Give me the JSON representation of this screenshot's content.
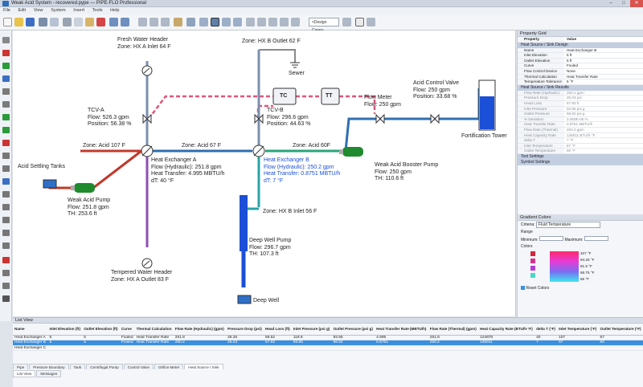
{
  "window": {
    "title": "Weak Acid System - recovered.pype — PIPE-FLO Professional"
  },
  "menu": [
    "File",
    "Edit",
    "View",
    "System",
    "Insert",
    "Tools",
    "Help"
  ],
  "toolbar": {
    "design_case": "<Design Case>"
  },
  "diagram": {
    "fresh_water_header": [
      "Fresh Water Header",
      "Zone: HX A Inlet 64 F"
    ],
    "zone_hxb_outlet": "Zone: HX B Outlet 62 F",
    "sewer": "Sewer",
    "tc": "TC",
    "tt": "TT",
    "flow_meter": [
      "Flow Meter",
      "Flow: 250 gpm"
    ],
    "acid_control_valve": [
      "Acid Control Valve",
      "Flow: 250 gpm",
      "Position: 33.68 %"
    ],
    "tcv_a": [
      "TCV-A",
      "Flow: 526.3 gpm",
      "Position: 56.38 %"
    ],
    "tcv_b": [
      "TCV-B",
      "Flow: 296.6 gpm",
      "Position: 44.63 %"
    ],
    "fortification_tower": "Fortification Tower",
    "zone_acid107": "Zone: Acid 107 F",
    "zone_acid67": "Zone: Acid 67 F",
    "zone_acid60": "Zone: Acid 60F",
    "acid_settling_tanks": "Acid Settling Tanks",
    "hx_a": [
      "Heat Exchanger A",
      "Flow (Hydraulic): 251.8 gpm",
      "Heat Transfer: 4.995 MBTU/h",
      "dT: 40 °F"
    ],
    "hx_b": [
      "Heat Exchanger B",
      "Flow (Hydraulic): 250.2 gpm",
      "Heat Transfer: 0.8751 MBTU/h",
      "dT: 7 °F"
    ],
    "booster_pump": [
      "Weak Acid Booster Pump",
      "Flow: 250 gpm",
      "TH: 110.6 ft"
    ],
    "weak_acid_pump": [
      "Weak Acid Pump",
      "Flow: 251.8 gpm",
      "TH: 253.6 ft"
    ],
    "zone_hxb_inlet": "Zone: HX B Inlet 56 F",
    "deep_well_pump": [
      "Deep Well Pump",
      "Flow: 296.7 gpm",
      "TH: 107.3 ft"
    ],
    "tempered_water_header": [
      "Tempered Water Header",
      "Zone: HX A Outlet 83 F"
    ],
    "deep_well": "Deep Well"
  },
  "property_grid": {
    "title": "Property Grid",
    "col_property": "Property",
    "col_value": "Value",
    "section1": "Heat Source / Sink Design",
    "design_rows": [
      [
        "Name",
        "Heat Exchanger B"
      ],
      [
        "Inlet Elevation",
        "5 ft"
      ],
      [
        "Outlet Elevation",
        "5 ft"
      ],
      [
        "Curve",
        "Fouled"
      ],
      [
        "Flow Control Device",
        "None"
      ],
      [
        "Thermal Calculation",
        "Heat Transfer Rate"
      ],
      [
        "Temperature Tolerance",
        "5 °F"
      ]
    ],
    "section2": "Heat Source / Sink Results",
    "result_rows": [
      [
        "Flow Rate (Hydraulic)",
        "250.2 gpm"
      ],
      [
        "Pressure Drop",
        "25.03 psi"
      ],
      [
        "Head Loss",
        "57.82 ft"
      ],
      [
        "Inlet Pressure",
        "93.85 psi g"
      ],
      [
        "Outlet Pressure",
        "68.82 psi g"
      ],
      [
        "% Deviation",
        "3.050E-06 %"
      ],
      [
        "Heat Transfer Rate",
        "0.8751 MBTU/h"
      ],
      [
        "Flow Rate (Thermal)",
        "250.2 gpm"
      ],
      [
        "Heat Capacity Rate",
        "125011 BTU/h·°F"
      ],
      [
        "delta T",
        "7 °F"
      ],
      [
        "Inlet Temperature",
        "67 °F"
      ],
      [
        "Outlet Temperature",
        "60 °F"
      ]
    ],
    "section3": "Text Settings",
    "section4": "Symbol Settings"
  },
  "gradient": {
    "title": "Gradient Colors",
    "criteria_label": "Criteria:",
    "criteria_value": "Fluid Temperature",
    "range_label": "Range",
    "min_label": "Minimum:",
    "max_label": "Maximum:",
    "colors_label": "Colors",
    "stops": [
      "107 °F",
      "94.25 °F",
      "81.5 °F",
      "68.75 °F",
      "56 °F"
    ],
    "reset": "Reset Colors"
  },
  "list_view": {
    "title": "List View",
    "columns": [
      "Name",
      "Inlet Elevation (ft)",
      "Outlet Elevation (ft)",
      "Curve",
      "Thermal Calculation",
      "Flow Rate (Hydraulic) (gpm)",
      "Pressure Drop (psi)",
      "Head Loss (ft)",
      "Inlet Pressure (psi g)",
      "Outlet Pressure (psi g)",
      "Heat Transfer Rate (MBTU/h)",
      "Flow Rate (Thermal) (gpm)",
      "Heat Capacity Rate (BTU/h·°F)",
      "delta T (°F)",
      "Inlet Temperature (°F)",
      "Outlet Temperature (°F)"
    ],
    "rows": [
      [
        "Heat Exchanger A",
        "5",
        "5",
        "Fouled",
        "Heat Transfer Rate",
        "251.8",
        "25.36",
        "58.62",
        "118.9",
        "93.55",
        "4.995",
        "251.8",
        "124878",
        "40",
        "107",
        "67"
      ],
      [
        "Heat Exchanger B",
        "5",
        "5",
        "Fouled",
        "Heat Transfer Rate",
        "250.2",
        "25.03",
        "57.82",
        "93.85",
        "68.82",
        "0.8751",
        "250.2",
        "125011",
        "7",
        "67",
        "60"
      ],
      [
        "Heat Exchanger C",
        "",
        "",
        "",
        "",
        "",
        "",
        "",
        "",
        "",
        "",
        "",
        "",
        "",
        "",
        ""
      ]
    ],
    "tabs": [
      "Pipe",
      "Pressure Boundary",
      "Tank",
      "Centrifugal Pump",
      "Control Valve",
      "Orifice Meter",
      "Heat Source / Sink"
    ],
    "bottom_tabs": [
      "List View",
      "Messages"
    ]
  },
  "colors": {
    "acid": "#2a9a3a",
    "water": "#1b4fd8",
    "hot": "#c0392b",
    "control": "#e0557a",
    "sewer": "#8a8a8a"
  }
}
